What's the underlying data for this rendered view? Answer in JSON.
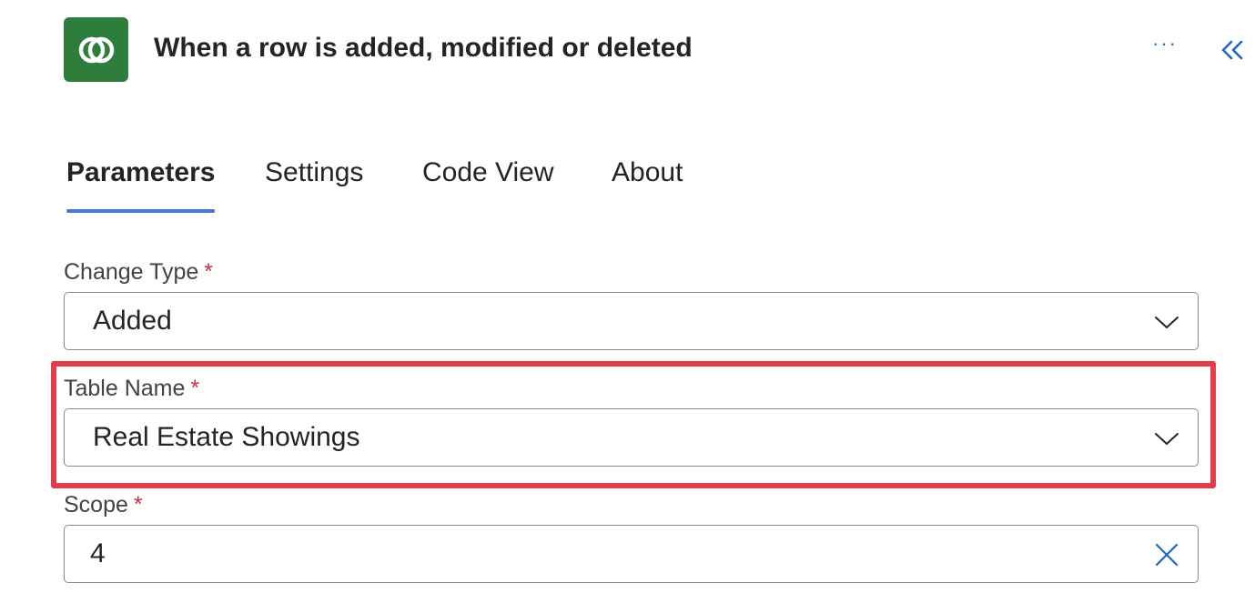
{
  "header": {
    "title": "When a row is added, modified or deleted",
    "app_icon": "dataverse-icon",
    "app_icon_color": "#2f7d3c",
    "more_label": "···",
    "collapse_icon": "double-chevron-left-icon"
  },
  "tabs": [
    {
      "label": "Parameters",
      "active": true
    },
    {
      "label": "Settings",
      "active": false
    },
    {
      "label": "Code View",
      "active": false
    },
    {
      "label": "About",
      "active": false
    }
  ],
  "fields": {
    "change_type": {
      "label": "Change Type",
      "required_mark": "*",
      "value": "Added",
      "icon": "chevron-down-icon"
    },
    "table_name": {
      "label": "Table Name",
      "required_mark": "*",
      "value": "Real Estate Showings",
      "icon": "chevron-down-icon",
      "highlighted": true
    },
    "scope": {
      "label": "Scope",
      "required_mark": "*",
      "value": "4",
      "icon": "close-icon"
    }
  },
  "colors": {
    "accent": "#4a78c8",
    "highlight_border": "#e43c48",
    "required": "#c4314b"
  }
}
